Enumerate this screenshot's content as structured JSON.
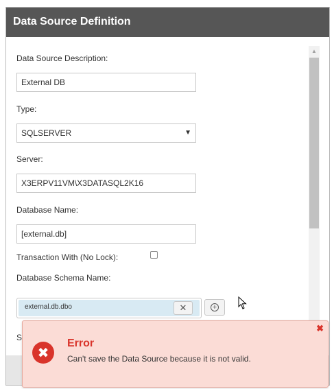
{
  "dialog": {
    "title": "Data Source Definition"
  },
  "form": {
    "description_label": "Data Source Description:",
    "description_value": "External DB",
    "type_label": "Type:",
    "type_value": "SQLSERVER",
    "server_label": "Server:",
    "server_value": "X3ERPV11VM\\X3DATASQL2K16",
    "database_label": "Database Name:",
    "database_value": "[external.db]",
    "transaction_label": "Transaction With (No Lock):",
    "transaction_checked": false,
    "schema_label": "Database Schema Name:",
    "schema_tags": [
      "external.db.dbo"
    ],
    "next_label_partial": "S"
  },
  "icons": {
    "select_arrow": "▼",
    "tag_remove": "✕",
    "add": "+",
    "scroll_up": "▲",
    "error": "✖",
    "close": "✖"
  },
  "error": {
    "title": "Error",
    "message": "Can't save the Data Source because it is not valid."
  },
  "colors": {
    "titlebar": "#565656",
    "error_accent": "#d9342b",
    "error_background": "#fbdcd6",
    "tag_background": "#d8eaf3"
  }
}
